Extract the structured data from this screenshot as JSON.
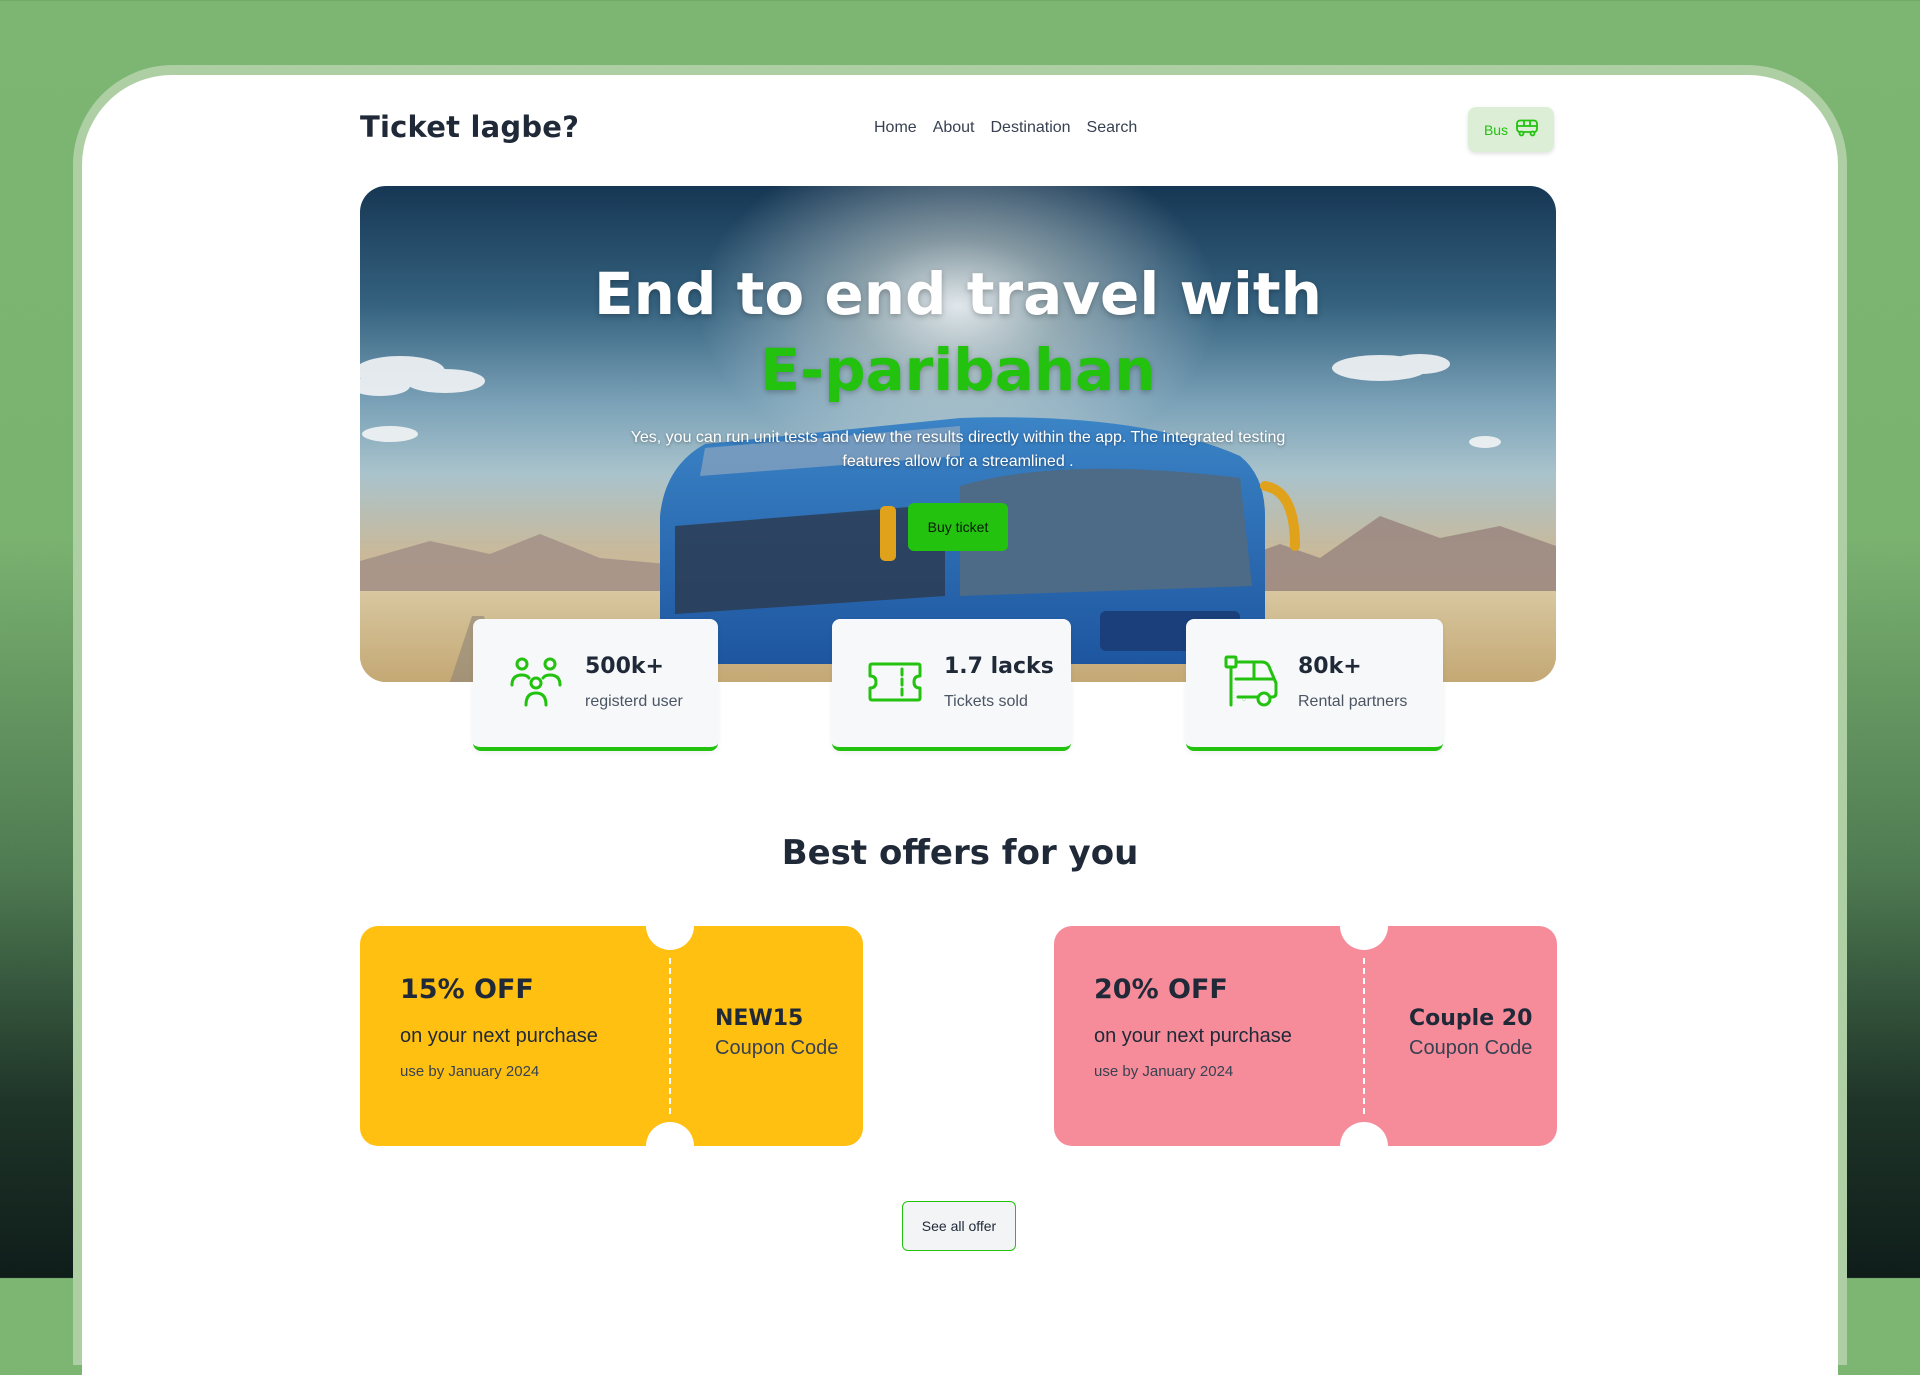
{
  "nav": {
    "logo": "Ticket lagbe?",
    "links": [
      "Home",
      "About",
      "Destination",
      "Search"
    ],
    "bus_button": {
      "label": "Bus",
      "icon": "bus-icon"
    }
  },
  "hero": {
    "title_line1": "End to end travel with",
    "title_line2": "E-paribahan",
    "subtitle": "Yes, you can run unit tests and view the results directly within the app. The integrated testing features allow for a streamlined .",
    "button": "Buy ticket"
  },
  "stats": [
    {
      "value": "500k+",
      "label": "registerd user",
      "icon": "users-icon"
    },
    {
      "value": "1.7 lacks",
      "label": "Tickets sold",
      "icon": "ticket-icon"
    },
    {
      "value": "80k+",
      "label": "Rental partners",
      "icon": "rental-vehicle-icon"
    }
  ],
  "offers": {
    "title": "Best offers for you",
    "coupons": [
      {
        "discount": "15% OFF",
        "description": "on your next purchase",
        "validity": "use by January 2024",
        "code": "NEW15",
        "code_label": "Coupon Code",
        "color": "#ffc012"
      },
      {
        "discount": "20% OFF",
        "description": "on your next purchase",
        "validity": "use by January 2024",
        "code": "Couple 20",
        "code_label": "Coupon Code",
        "color": "#f68c9a"
      }
    ],
    "see_all": "See all offer"
  },
  "colors": {
    "accent": "#22c20e",
    "text": "#1f2937",
    "coupon_yellow": "#ffc012",
    "coupon_pink": "#f68c9a"
  }
}
